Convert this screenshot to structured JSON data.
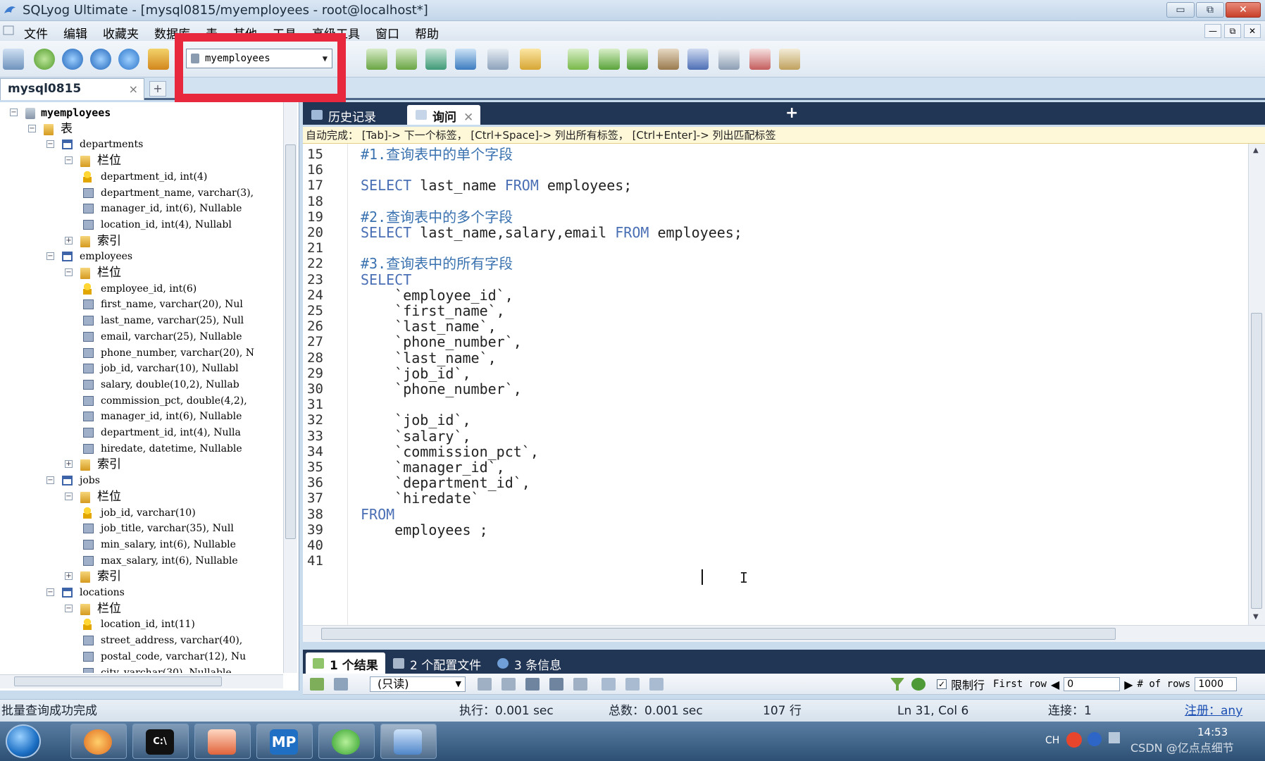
{
  "window": {
    "title": "SQLyog Ultimate - [mysql0815/myemployees - root@localhost*]",
    "buttons": [
      "▭",
      "⧉",
      "✕"
    ]
  },
  "menu": {
    "items": [
      "文件",
      "编辑",
      "收藏夹",
      "数据库",
      "表",
      "其他",
      "工具",
      "高级工具",
      "窗口",
      "帮助"
    ],
    "mdi_buttons": [
      "—",
      "⧉",
      "✕"
    ]
  },
  "toolbar": {
    "database_select": "myemployees"
  },
  "connection_tab": {
    "label": "mysql0815",
    "close": "×",
    "add": "+"
  },
  "tree": {
    "rows": [
      {
        "text": "myemployees",
        "kind": "db",
        "exp": "−"
      },
      {
        "text": "表",
        "kind": "folder",
        "exp": "−"
      },
      {
        "text": "departments",
        "kind": "table",
        "exp": "−"
      },
      {
        "text": "栏位",
        "kind": "folder",
        "exp": "−"
      },
      {
        "text": "department_id, int(4)",
        "kind": "key",
        "exp": ""
      },
      {
        "text": "department_name, varchar(3),",
        "kind": "col",
        "exp": ""
      },
      {
        "text": "manager_id, int(6), Nullable",
        "kind": "col",
        "exp": ""
      },
      {
        "text": "location_id, int(4), Nullabl",
        "kind": "col",
        "exp": ""
      },
      {
        "text": "索引",
        "kind": "folder",
        "exp": "+"
      },
      {
        "text": "employees",
        "kind": "table",
        "exp": "−"
      },
      {
        "text": "栏位",
        "kind": "folder",
        "exp": "−"
      },
      {
        "text": "employee_id, int(6)",
        "kind": "key",
        "exp": ""
      },
      {
        "text": "first_name, varchar(20), Nul",
        "kind": "col",
        "exp": ""
      },
      {
        "text": "last_name, varchar(25), Null",
        "kind": "col",
        "exp": ""
      },
      {
        "text": "email, varchar(25), Nullable",
        "kind": "col",
        "exp": ""
      },
      {
        "text": "phone_number, varchar(20), N",
        "kind": "col",
        "exp": ""
      },
      {
        "text": "job_id, varchar(10), Nullabl",
        "kind": "col",
        "exp": ""
      },
      {
        "text": "salary, double(10,2), Nullab",
        "kind": "col",
        "exp": ""
      },
      {
        "text": "commission_pct, double(4,2),",
        "kind": "col",
        "exp": ""
      },
      {
        "text": "manager_id, int(6), Nullable",
        "kind": "col",
        "exp": ""
      },
      {
        "text": "department_id, int(4), Nulla",
        "kind": "col",
        "exp": ""
      },
      {
        "text": "hiredate, datetime, Nullable",
        "kind": "col",
        "exp": ""
      },
      {
        "text": "索引",
        "kind": "folder",
        "exp": "+"
      },
      {
        "text": "jobs",
        "kind": "table",
        "exp": "−"
      },
      {
        "text": "栏位",
        "kind": "folder",
        "exp": "−"
      },
      {
        "text": "job_id, varchar(10)",
        "kind": "key",
        "exp": ""
      },
      {
        "text": "job_title, varchar(35), Null",
        "kind": "col",
        "exp": ""
      },
      {
        "text": "min_salary, int(6), Nullable",
        "kind": "col",
        "exp": ""
      },
      {
        "text": "max_salary, int(6), Nullable",
        "kind": "col",
        "exp": ""
      },
      {
        "text": "索引",
        "kind": "folder",
        "exp": "+"
      },
      {
        "text": "locations",
        "kind": "table",
        "exp": "−"
      },
      {
        "text": "栏位",
        "kind": "folder",
        "exp": "−"
      },
      {
        "text": "location_id, int(11)",
        "kind": "key",
        "exp": ""
      },
      {
        "text": "street_address, varchar(40),",
        "kind": "col",
        "exp": ""
      },
      {
        "text": "postal_code, varchar(12), Nu",
        "kind": "col",
        "exp": ""
      },
      {
        "text": "city, varchar(30), Nullable",
        "kind": "col",
        "exp": ""
      }
    ]
  },
  "query_tabs": {
    "history": "历史记录",
    "query": "询问",
    "close": "✕",
    "add": "+"
  },
  "autocomplete_hint": "自动完成： [Tab]-> 下一个标签， [Ctrl+Space]-> 列出所有标签， [Ctrl+Enter]-> 列出匹配标签",
  "editor": {
    "lines": [
      {
        "n": "15",
        "indent": "",
        "tokens": [
          {
            "t": "#1.查询表中的单个字段",
            "c": "cm"
          }
        ]
      },
      {
        "n": "16",
        "indent": "",
        "tokens": []
      },
      {
        "n": "17",
        "indent": "",
        "tokens": [
          {
            "t": "SELECT",
            "c": "kw"
          },
          {
            "t": " last_name ",
            "c": ""
          },
          {
            "t": "FROM",
            "c": "kw"
          },
          {
            "t": " employees;",
            "c": ""
          }
        ]
      },
      {
        "n": "18",
        "indent": "",
        "tokens": []
      },
      {
        "n": "19",
        "indent": "",
        "tokens": [
          {
            "t": "#2.查询表中的多个字段",
            "c": "cm"
          }
        ]
      },
      {
        "n": "20",
        "indent": "",
        "tokens": [
          {
            "t": "SELECT",
            "c": "kw"
          },
          {
            "t": " last_name,salary,email ",
            "c": ""
          },
          {
            "t": "FROM",
            "c": "kw"
          },
          {
            "t": " employees;",
            "c": ""
          }
        ]
      },
      {
        "n": "21",
        "indent": "",
        "tokens": []
      },
      {
        "n": "22",
        "indent": "",
        "tokens": [
          {
            "t": "#3.查询表中的所有字段",
            "c": "cm"
          }
        ]
      },
      {
        "n": "23",
        "indent": "",
        "tokens": [
          {
            "t": "SELECT",
            "c": "kw"
          }
        ]
      },
      {
        "n": "24",
        "indent": "    ",
        "tokens": [
          {
            "t": "`employee_id`,",
            "c": ""
          }
        ]
      },
      {
        "n": "25",
        "indent": "    ",
        "tokens": [
          {
            "t": "`first_name`,",
            "c": ""
          }
        ]
      },
      {
        "n": "26",
        "indent": "    ",
        "tokens": [
          {
            "t": "`last_name`,",
            "c": ""
          }
        ]
      },
      {
        "n": "27",
        "indent": "    ",
        "tokens": [
          {
            "t": "`phone_number`,",
            "c": ""
          }
        ]
      },
      {
        "n": "28",
        "indent": "    ",
        "tokens": [
          {
            "t": "`last_name`,",
            "c": ""
          }
        ]
      },
      {
        "n": "29",
        "indent": "    ",
        "tokens": [
          {
            "t": "`job_id`,",
            "c": ""
          }
        ]
      },
      {
        "n": "30",
        "indent": "    ",
        "tokens": [
          {
            "t": "`phone_number`,",
            "c": ""
          }
        ]
      },
      {
        "n": "31",
        "indent": "",
        "tokens": []
      },
      {
        "n": "32",
        "indent": "    ",
        "tokens": [
          {
            "t": "`job_id`,",
            "c": ""
          }
        ]
      },
      {
        "n": "33",
        "indent": "    ",
        "tokens": [
          {
            "t": "`salary`,",
            "c": ""
          }
        ]
      },
      {
        "n": "34",
        "indent": "    ",
        "tokens": [
          {
            "t": "`commission_pct`,",
            "c": ""
          }
        ]
      },
      {
        "n": "35",
        "indent": "    ",
        "tokens": [
          {
            "t": "`manager_id`,",
            "c": ""
          }
        ]
      },
      {
        "n": "36",
        "indent": "    ",
        "tokens": [
          {
            "t": "`department_id`,",
            "c": ""
          }
        ]
      },
      {
        "n": "37",
        "indent": "    ",
        "tokens": [
          {
            "t": "`hiredate`",
            "c": ""
          }
        ]
      },
      {
        "n": "38",
        "indent": "",
        "tokens": [
          {
            "t": "FROM",
            "c": "kw"
          }
        ]
      },
      {
        "n": "39",
        "indent": "    ",
        "tokens": [
          {
            "t": "employees ;",
            "c": ""
          }
        ]
      },
      {
        "n": "40",
        "indent": "",
        "tokens": []
      },
      {
        "n": "41",
        "indent": "",
        "tokens": []
      }
    ]
  },
  "result_tabs": [
    "1 个结果",
    "2 个配置文件",
    "3 条信息"
  ],
  "result_toolbar": {
    "mode_select": "(只读)",
    "limit_label": "限制行",
    "first_row_label": "First row",
    "first_row_value": "0",
    "rows_label": "# of rows",
    "rows_value": "1000"
  },
  "status": {
    "message": "批量查询成功完成",
    "exec": "执行：0.001 sec",
    "total": "总数：0.001 sec",
    "rows": "107 行",
    "position": "Ln 31, Col 6",
    "connections": "连接：1",
    "register": "注册：any"
  },
  "taskbar": {
    "apps": [
      "",
      "C:\\",
      "",
      "MP",
      "",
      ""
    ],
    "tray_lang": "CH",
    "clock": "14:53",
    "watermark": "CSDN @亿点点细节"
  },
  "colors": {
    "keyword": "#4a6fb5",
    "comment": "#3a72b0",
    "highlight_box": "#e8293d",
    "tab_strip": "#213554"
  }
}
